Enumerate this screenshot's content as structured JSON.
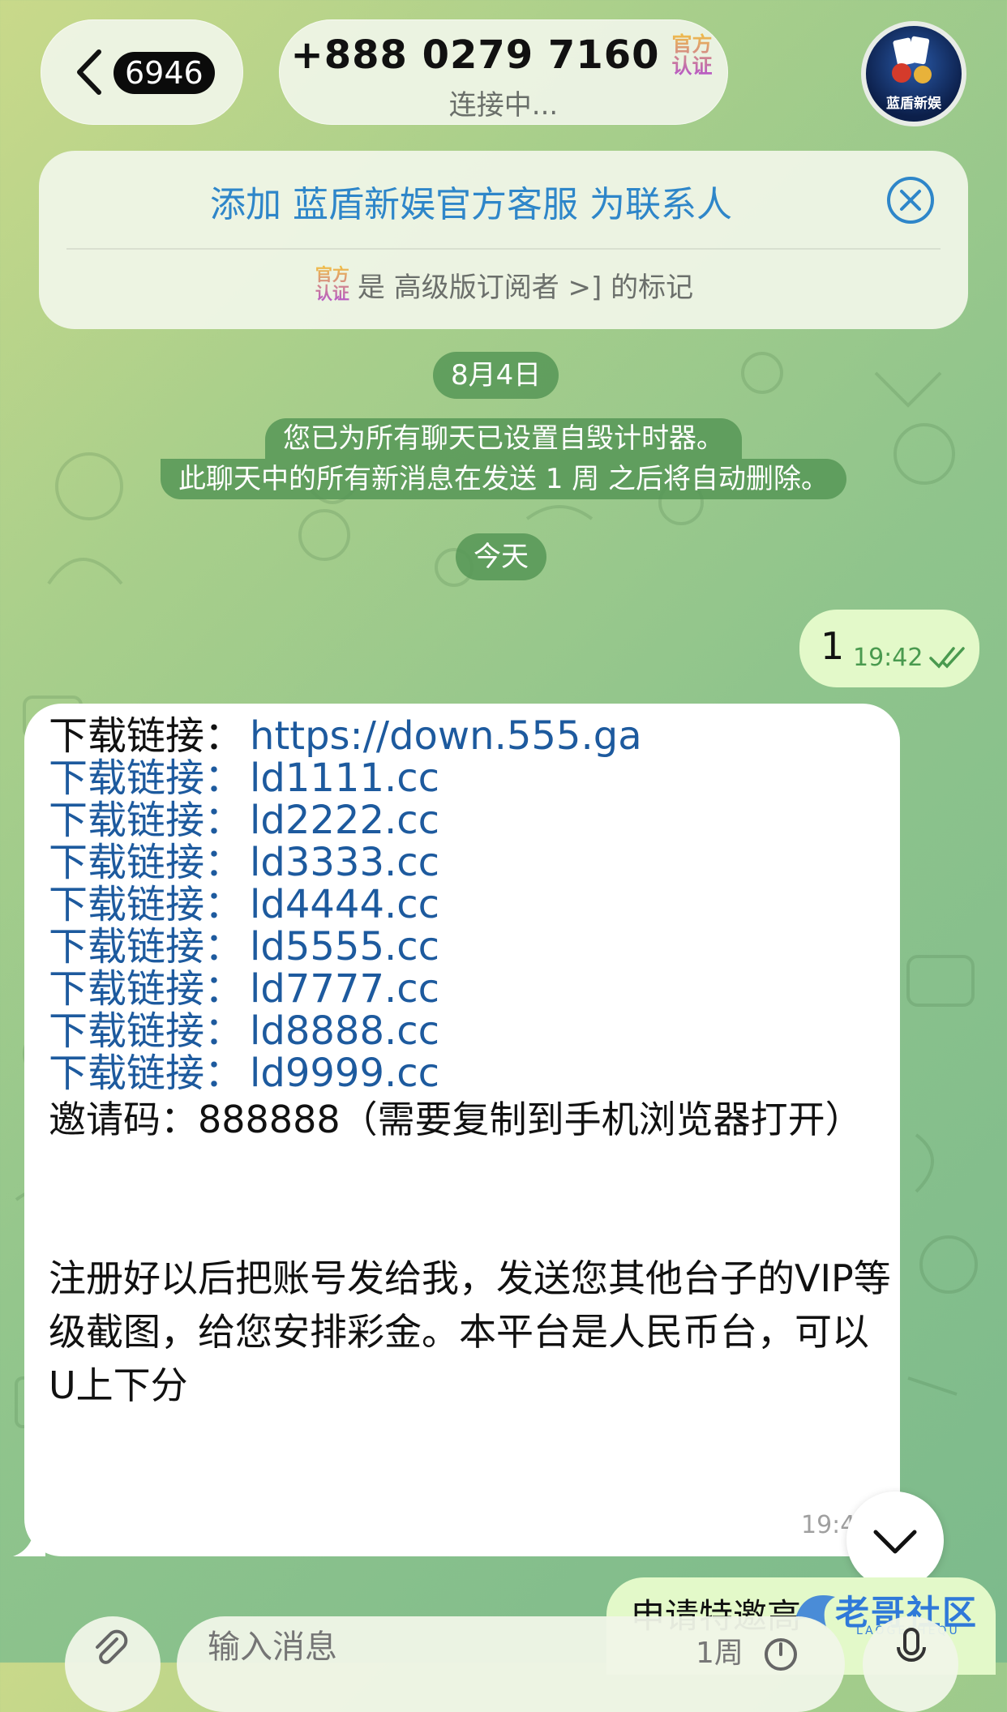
{
  "header": {
    "unread_count": "6946",
    "chat_title": "+888 0279 7160",
    "verify_badge_top": "官方",
    "verify_badge_bottom": "认证",
    "status": "连接中...",
    "avatar_label": "蓝盾新娱"
  },
  "banner": {
    "add_contact": "添加 蓝盾新娱官方客服 为联系人",
    "badge_top": "官方",
    "badge_bottom": "认证",
    "subtitle": "是 高级版订阅者 >] 的标记"
  },
  "timeline": {
    "date_aug4": "8月4日",
    "service_line1": "您已为所有聊天已设置自毁计时器。",
    "service_line2": "此聊天中的所有新消息在发送 1 周 之后将自动删除。",
    "date_today": "今天"
  },
  "outgoing_1": {
    "text": "1",
    "time": "19:42"
  },
  "incoming": {
    "links": [
      {
        "label": "下载链接：",
        "url": "https://down.555.ga"
      },
      {
        "label": "下载链接：",
        "url": "ld1111.cc"
      },
      {
        "label": "下载链接：",
        "url": "ld2222.cc"
      },
      {
        "label": "下载链接：",
        "url": "ld3333.cc"
      },
      {
        "label": "下载链接：",
        "url": "ld4444.cc"
      },
      {
        "label": "下载链接：",
        "url": "ld5555.cc"
      },
      {
        "label": "下载链接：",
        "url": "ld7777.cc"
      },
      {
        "label": "下载链接：",
        "url": "ld8888.cc"
      },
      {
        "label": "下载链接：",
        "url": "ld9999.cc"
      }
    ],
    "invite": "邀请码：888888（需要复制到手机浏览器打开）",
    "body": "注册好以后把账号发给我，发送您其他台子的VIP等级截图，给您安排彩金。本平台是人民币台，可以U上下分",
    "time": "19:4"
  },
  "outgoing_2": {
    "text": "申请特邀高"
  },
  "watermark": {
    "text": "老哥社区",
    "sub": "LAOGESHEQU"
  },
  "composer": {
    "placeholder": "输入消息",
    "timer": "1周"
  },
  "colors": {
    "link": "#1d5a9e",
    "bubble_out": "#e3f9c9",
    "service_bg": "#569656",
    "accent": "#2e86c9"
  }
}
